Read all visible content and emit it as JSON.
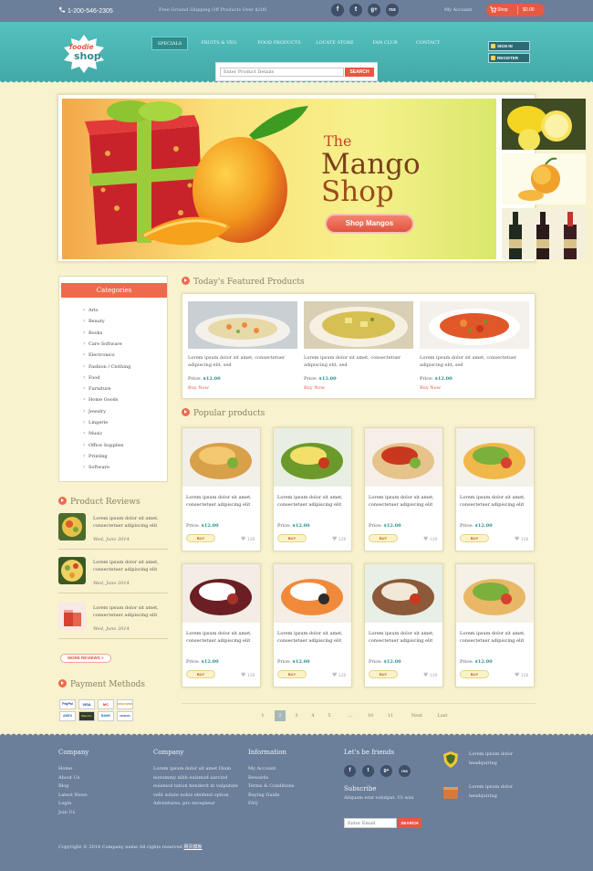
{
  "topbar": {
    "phone": "1-200-546-2305",
    "promo": "Free Ground Shipping Off Products Over $200",
    "social": [
      "f",
      "t",
      "g+",
      "rss"
    ],
    "account": "My Account",
    "cart_label": "Shop",
    "cart_amount": "$0.00"
  },
  "header": {
    "logo_top": "foodie",
    "logo_bottom": "shop",
    "nav": [
      "SPECIALS",
      "FRUITS & VEG",
      "FOOD PRODUCTS",
      "LOCATE STORE",
      "FAN CLUB",
      "CONTACT"
    ],
    "sign_in": "SIGN IN",
    "register": "REGISTER",
    "search_placeholder": "Enter Product Details",
    "search_button": "SEARCH"
  },
  "banner": {
    "title_the": "The",
    "title_mango": "Mango",
    "title_shop": "Shop",
    "cta": "Shop Mangos"
  },
  "sidebar": {
    "categories_title": "Categories",
    "categories": [
      "Arts",
      "Beauty",
      "Books",
      "Care Software",
      "Electronics",
      "Fashion / Clothing",
      "Food",
      "Furniture",
      "Home Goods",
      "Jewelry",
      "Lingerie",
      "Music",
      "Office Supplies",
      "Printing",
      "Software"
    ],
    "reviews_title": "Product Reviews",
    "reviews": [
      {
        "text": "Lorem ipsum dolor sit amet, consectetuer adipiscing elit",
        "date": "Wed, June 2014"
      },
      {
        "text": "Lorem ipsum dolor sit amet, consectetuer adipiscing elit",
        "date": "Wed, June 2014"
      },
      {
        "text": "Lorem ipsum dolor sit amet, consectetuer adipiscing elit",
        "date": "Wed, June 2014"
      }
    ],
    "more_reviews": "MORE REVIEWS >",
    "payment_title": "Payment Methods",
    "payment_cards": [
      "PayPal",
      "VISA",
      "MC",
      "DISCOVER",
      "AMEX",
      "Maestro",
      "BANK",
      "DINERS"
    ]
  },
  "featured": {
    "title": "Today's Featured Products",
    "items": [
      {
        "desc": "Lorem ipsum dolor sit amet, consectetuer adipiscing elit, sed",
        "price_label": "Price:",
        "price": "$12.00",
        "buy": "Buy Now"
      },
      {
        "desc": "Lorem ipsum dolor sit amet, consectetuer adipiscing elit, sed",
        "price_label": "Price:",
        "price": "$12.00",
        "buy": "Buy Now"
      },
      {
        "desc": "Lorem ipsum dolor sit amet, consectetuer adipiscing elit, sed",
        "price_label": "Price:",
        "price": "$12.00",
        "buy": "Buy Now"
      }
    ]
  },
  "popular": {
    "title": "Popular products",
    "items": [
      {
        "desc": "Lorem ipsum dolor sit amet, consectetuer adipiscing elit",
        "price_label": "Price:",
        "price": "$12.00",
        "buy": "BUY",
        "likes": "120"
      },
      {
        "desc": "Lorem ipsum dolor sit amet, consectetuer adipiscing elit",
        "price_label": "Price:",
        "price": "$12.00",
        "buy": "BUY",
        "likes": "120"
      },
      {
        "desc": "Lorem ipsum dolor sit amet, consectetuer adipiscing elit",
        "price_label": "Price:",
        "price": "$12.00",
        "buy": "BUY",
        "likes": "120"
      },
      {
        "desc": "Lorem ipsum dolor sit amet, consectetuer adipiscing elit",
        "price_label": "Price:",
        "price": "$12.00",
        "buy": "BUY",
        "likes": "120"
      },
      {
        "desc": "Lorem ipsum dolor sit amet, consectetuer adipiscing elit",
        "price_label": "Price:",
        "price": "$12.00",
        "buy": "BUY",
        "likes": "120"
      },
      {
        "desc": "Lorem ipsum dolor sit amet, consectetuer adipiscing elit",
        "price_label": "Price:",
        "price": "$12.00",
        "buy": "BUY",
        "likes": "120"
      },
      {
        "desc": "Lorem ipsum dolor sit amet, consectetuer adipiscing elit",
        "price_label": "Price:",
        "price": "$12.00",
        "buy": "BUY",
        "likes": "120"
      },
      {
        "desc": "Lorem ipsum dolor sit amet, consectetuer adipiscing elit",
        "price_label": "Price:",
        "price": "$12.00",
        "buy": "BUY",
        "likes": "120"
      }
    ]
  },
  "pagination": [
    "1",
    "2",
    "3",
    "4",
    "5",
    "...",
    "10",
    "11",
    "Next",
    "Last"
  ],
  "footer": {
    "col1_title": "Company",
    "col1_links": [
      "Home",
      "About Us",
      "Blog",
      "Latest News",
      "Login",
      "Join Us"
    ],
    "col2_title": "Company",
    "col2_text": "Lorem ipsum dolor sit amet Diam nonummy nibh euismod aarcind euismod tation henderit in vulputate velit solute nobis eleifend option Adventures, pro excepteur",
    "col3_title": "Information",
    "col3_links": [
      "My Account",
      "Rewards",
      "Terms & Conditions",
      "Buying Guide",
      "FAQ"
    ],
    "friends_title": "Let's be friends",
    "subscribe_title": "Subscribe",
    "subscribe_text": "Aliquam erat volutpat. Ut wisi",
    "subscribe_placeholder": "Enter Email",
    "subscribe_button": "SEARCH",
    "badge1": "Lorem ipsum dolor headquiring",
    "badge2": "Lorem ipsum dolor headquiring",
    "copyright": "Copyright © 2014 Company name All rights reserved",
    "copyright_link": "网页模板"
  }
}
